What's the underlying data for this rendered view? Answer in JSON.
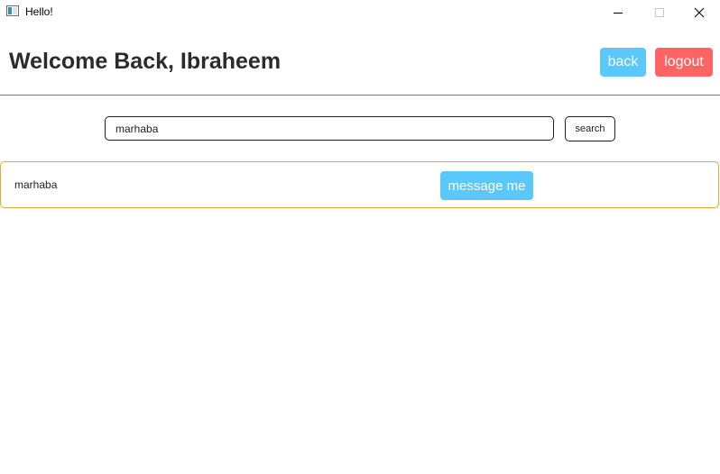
{
  "window": {
    "title": "Hello!",
    "icon": "app-window-icon",
    "controls": {
      "minimize_icon": "minimize-icon",
      "maximize_icon": "maximize-icon",
      "close_icon": "close-icon"
    }
  },
  "header": {
    "title": "Welcome Back, Ibraheem",
    "back_label": "back",
    "logout_label": "logout"
  },
  "search": {
    "value": "marhaba",
    "button_label": "search"
  },
  "results": [
    {
      "name": "marhaba",
      "action_label": "message me"
    }
  ],
  "colors": {
    "back_button": "#5ac8fa",
    "logout_button": "#ff6363",
    "message_button": "#5ac8fa",
    "header_divider": "#d9534f",
    "result_border": "#e6a53a",
    "title_text": "#2b2b2b"
  }
}
